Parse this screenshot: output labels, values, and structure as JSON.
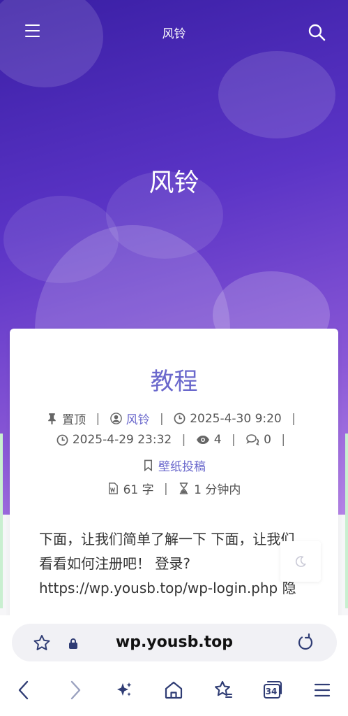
{
  "header": {
    "site_title": "风铃",
    "hero_title": "风铃"
  },
  "post": {
    "title": "教程",
    "sticky_label": "置顶",
    "author": "风铃",
    "published": "2025-4-30 9:20",
    "updated": "2025-4-29 23:32",
    "views": "4",
    "comments": "0",
    "category": "壁纸投稿",
    "word_count": "61 字",
    "read_time": "1 分钟内",
    "excerpt_lines": [
      "下面，让我们简单了解一下 下面，让我们",
      "看看如何注册吧！ 登录?",
      "https://wp.yousb.top/wp-login.php 隐"
    ]
  },
  "browser": {
    "url": "wp.yousb.top",
    "tab_count": "34"
  },
  "colors": {
    "accent": "#6a68cc",
    "hero_gradient_start": "#3a1fa5",
    "hero_gradient_end": "#b483e6",
    "browser_icon": "#2f3c74"
  }
}
